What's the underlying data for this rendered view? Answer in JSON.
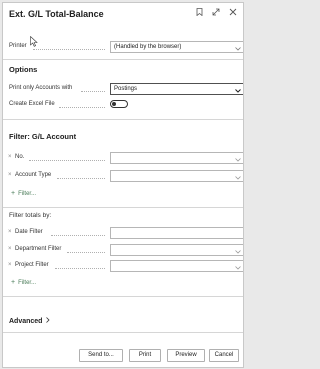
{
  "dialog": {
    "title": "Ext. G/L Total-Balance"
  },
  "printer": {
    "label": "Printer",
    "value": "(Handled by the browser)"
  },
  "options": {
    "heading": "Options",
    "print_only_label": "Print only Accounts with",
    "print_only_value": "Postings",
    "create_excel_label": "Create Excel File",
    "create_excel_value": false
  },
  "filter_gl": {
    "heading": "Filter: G/L Account",
    "fields": [
      {
        "label": "No.",
        "value": ""
      },
      {
        "label": "Account Type",
        "value": ""
      }
    ],
    "add_filter": "Filter..."
  },
  "filter_totals": {
    "heading": "Filter totals by:",
    "fields": [
      {
        "label": "Date Filter",
        "value": ""
      },
      {
        "label": "Department Filter",
        "value": ""
      },
      {
        "label": "Project Filter",
        "value": ""
      }
    ],
    "add_filter": "Filter..."
  },
  "advanced": {
    "label": "Advanced"
  },
  "buttons": {
    "send_to": "Send to...",
    "print": "Print",
    "preview": "Preview",
    "cancel": "Cancel"
  },
  "icons": [
    "bookmark-icon",
    "expand-icon",
    "close-icon",
    "cursor-icon",
    "chevron-down-icon",
    "chevron-right-icon",
    "plus-icon"
  ]
}
